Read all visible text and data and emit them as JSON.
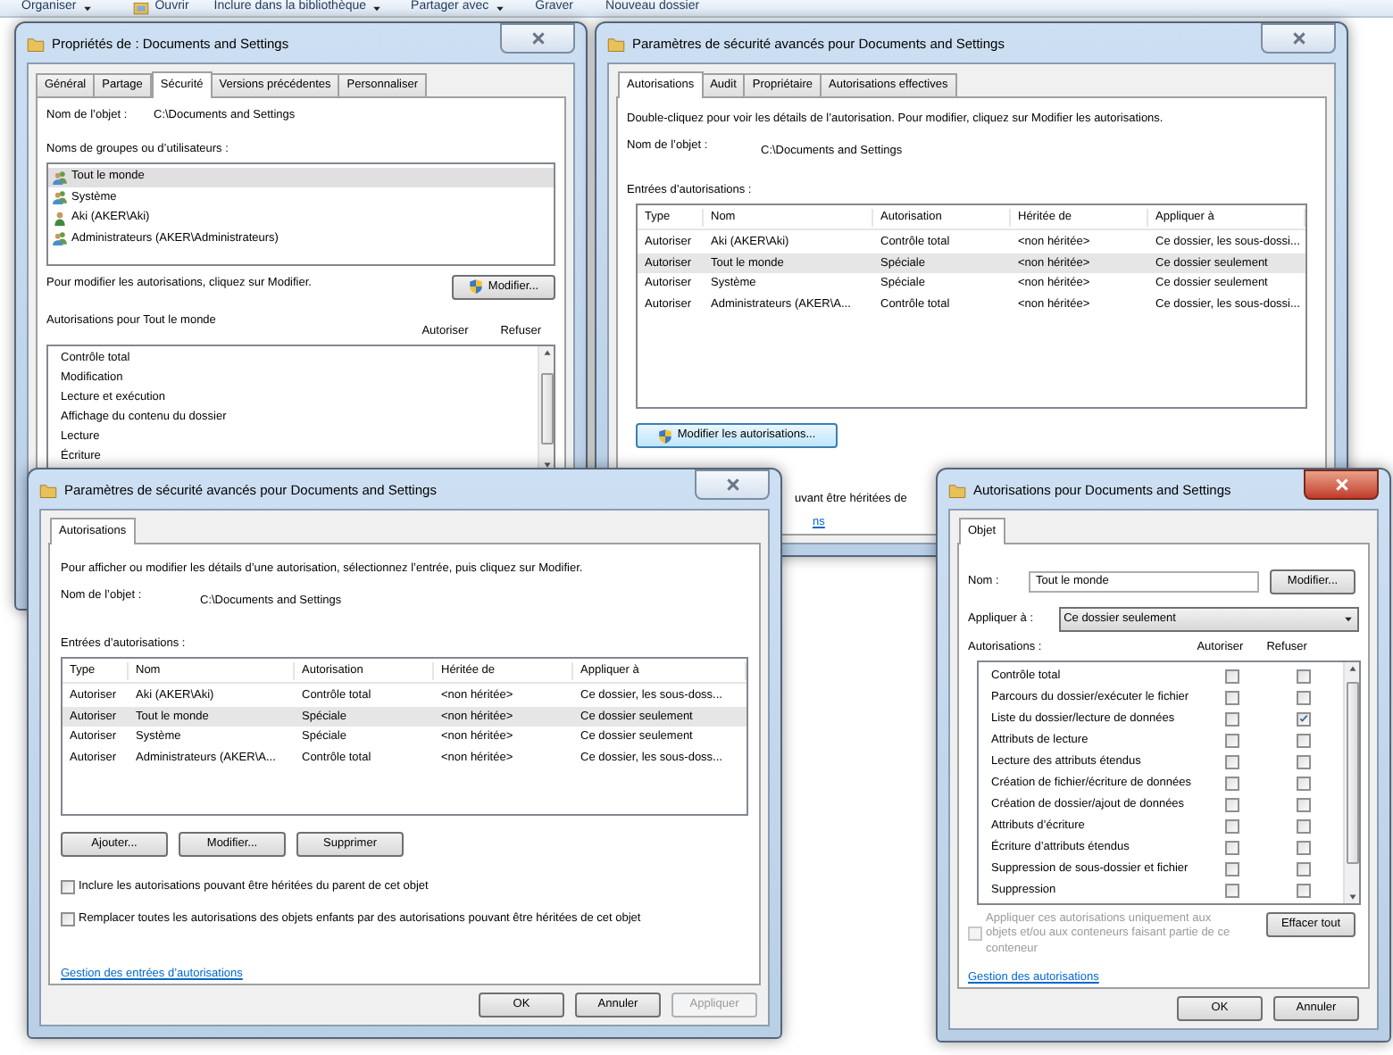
{
  "explorer_toolbar": [
    {
      "label": "Organiser",
      "kind": "dropdown"
    },
    {
      "label": "Ouvrir",
      "kind": "icon"
    },
    {
      "label": "Inclure dans la bibliothèque",
      "kind": "dropdown"
    },
    {
      "label": "Partager avec",
      "kind": "dropdown"
    },
    {
      "label": "Graver",
      "kind": "plain"
    },
    {
      "label": "Nouveau dossier",
      "kind": "plain"
    }
  ],
  "properties_window": {
    "title": "Propriétés de : Documents and Settings",
    "active": false,
    "tabs": [
      {
        "label": "Général",
        "selected": false
      },
      {
        "label": "Partage",
        "selected": false
      },
      {
        "label": "Sécurité",
        "selected": true
      },
      {
        "label": "Versions précédentes",
        "selected": false
      },
      {
        "label": "Personnaliser",
        "selected": false
      }
    ],
    "object_label": "Nom de l’objet :",
    "object_value": "C:\\Documents and Settings",
    "groups_label": "Noms de groupes ou d’utilisateurs :",
    "groups": [
      {
        "name": "Tout le monde",
        "kind": "group",
        "selected": true
      },
      {
        "name": "Système",
        "kind": "group",
        "selected": false
      },
      {
        "name": "Aki (AKER\\Aki)",
        "kind": "user",
        "selected": false
      },
      {
        "name": "Administrateurs (AKER\\Administrateurs)",
        "kind": "group",
        "selected": false
      }
    ],
    "edit_hint": "Pour modifier les autorisations, cliquez sur Modifier.",
    "edit_button": {
      "label": "Modifier...",
      "requires_admin": true,
      "focused": false
    },
    "permissions_label": "Autorisations pour Tout le monde",
    "columns": [
      "Autoriser",
      "Refuser"
    ],
    "permissions": [
      "Contrôle total",
      "Modification",
      "Lecture et exécution",
      "Affichage du contenu du dossier",
      "Lecture",
      "Écriture"
    ]
  },
  "advanced_window_back": {
    "title": "Paramètres de sécurité avancés pour Documents and Settings",
    "active": false,
    "tabs": [
      {
        "label": "Autorisations",
        "selected": true
      },
      {
        "label": "Audit",
        "selected": false
      },
      {
        "label": "Propriétaire",
        "selected": false
      },
      {
        "label": "Autorisations effectives",
        "selected": false
      }
    ],
    "description": "Double-cliquez pour voir les détails de l’autorisation. Pour modifier, cliquez sur Modifier les autorisations.",
    "object_label": "Nom de l’objet :",
    "object_value": "C:\\Documents and Settings",
    "entries_label": "Entrées d’autorisations :",
    "columns": [
      "Type",
      "Nom",
      "Autorisation",
      "Héritée de",
      "Appliquer à"
    ],
    "rows": [
      {
        "cells": [
          "Autoriser",
          "Aki (AKER\\Aki)",
          "Contrôle total",
          "<non héritée>",
          "Ce dossier, les sous-dossi..."
        ],
        "selected": false
      },
      {
        "cells": [
          "Autoriser",
          "Tout le monde",
          "Spéciale",
          "<non héritée>",
          "Ce dossier seulement"
        ],
        "selected": true
      },
      {
        "cells": [
          "Autoriser",
          "Système",
          "Spéciale",
          "<non héritée>",
          "Ce dossier seulement"
        ],
        "selected": false
      },
      {
        "cells": [
          "Autoriser",
          "Administrateurs (AKER\\A...",
          "Contrôle total",
          "<non héritée>",
          "Ce dossier, les sous-dossi..."
        ],
        "selected": false
      }
    ],
    "edit_button": {
      "label": "Modifier les autorisations...",
      "requires_admin": true,
      "focused": true
    },
    "inherit_text_partial": "uvant être héritées de",
    "link_partial": "ns"
  },
  "advanced_window_front": {
    "title": "Paramètres de sécurité avancés pour Documents and Settings",
    "active": false,
    "tabs": [
      {
        "label": "Autorisations",
        "selected": true
      }
    ],
    "description": "Pour afficher ou modifier les détails d’une autorisation, sélectionnez l’entrée, puis cliquez sur Modifier.",
    "object_label": "Nom de l’objet :",
    "object_value": "C:\\Documents and Settings",
    "entries_label": "Entrées d’autorisations :",
    "columns": [
      "Type",
      "Nom",
      "Autorisation",
      "Héritée de",
      "Appliquer à"
    ],
    "rows": [
      {
        "cells": [
          "Autoriser",
          "Aki (AKER\\Aki)",
          "Contrôle total",
          "<non héritée>",
          "Ce dossier, les sous-doss..."
        ],
        "selected": false
      },
      {
        "cells": [
          "Autoriser",
          "Tout le monde",
          "Spéciale",
          "<non héritée>",
          "Ce dossier seulement"
        ],
        "selected": true
      },
      {
        "cells": [
          "Autoriser",
          "Système",
          "Spéciale",
          "<non héritée>",
          "Ce dossier seulement"
        ],
        "selected": false
      },
      {
        "cells": [
          "Autoriser",
          "Administrateurs (AKER\\A...",
          "Contrôle total",
          "<non héritée>",
          "Ce dossier, les sous-doss..."
        ],
        "selected": false
      }
    ],
    "action_buttons": [
      "Ajouter...",
      "Modifier...",
      "Supprimer"
    ],
    "options": [
      {
        "label": "Inclure les autorisations pouvant être héritées du parent de cet objet",
        "checked": false
      },
      {
        "label": "Remplacer toutes les autorisations des objets enfants par des autorisations pouvant être héritées de cet objet",
        "checked": false
      }
    ],
    "link": "Gestion des entrées d’autorisations",
    "footer_buttons": [
      {
        "label": "OK",
        "disabled": false
      },
      {
        "label": "Annuler",
        "disabled": false
      },
      {
        "label": "Appliquer",
        "disabled": true
      }
    ]
  },
  "entry_window": {
    "title": "Autorisations pour Documents and Settings",
    "active": true,
    "tabs": [
      {
        "label": "Objet",
        "selected": true
      }
    ],
    "name_label": "Nom :",
    "name_value": "Tout le monde",
    "name_button": "Modifier...",
    "apply_label": "Appliquer à :",
    "apply_value": "Ce dossier seulement",
    "permissions_label": "Autorisations :",
    "columns": [
      "Autoriser",
      "Refuser"
    ],
    "permissions": [
      {
        "label": "Contrôle total",
        "allow": false,
        "deny": false
      },
      {
        "label": "Parcours du dossier/exécuter le fichier",
        "allow": false,
        "deny": false
      },
      {
        "label": "Liste du dossier/lecture de données",
        "allow": false,
        "deny": true
      },
      {
        "label": "Attributs de lecture",
        "allow": false,
        "deny": false
      },
      {
        "label": "Lecture des attributs étendus",
        "allow": false,
        "deny": false
      },
      {
        "label": "Création de fichier/écriture de données",
        "allow": false,
        "deny": false
      },
      {
        "label": "Création de dossier/ajout de données",
        "allow": false,
        "deny": false
      },
      {
        "label": "Attributs d’écriture",
        "allow": false,
        "deny": false
      },
      {
        "label": "Écriture d’attributs étendus",
        "allow": false,
        "deny": false
      },
      {
        "label": "Suppression de sous-dossier et fichier",
        "allow": false,
        "deny": false
      },
      {
        "label": "Suppression",
        "allow": false,
        "deny": false
      }
    ],
    "apply_only": {
      "label": "Appliquer ces autorisations uniquement aux objets et/ou aux conteneurs faisant partie de ce conteneur",
      "checked": false,
      "disabled": true
    },
    "clear_button": "Effacer tout",
    "link": "Gestion des autorisations",
    "footer_buttons": [
      {
        "label": "OK",
        "disabled": false
      },
      {
        "label": "Annuler",
        "disabled": false
      }
    ]
  }
}
